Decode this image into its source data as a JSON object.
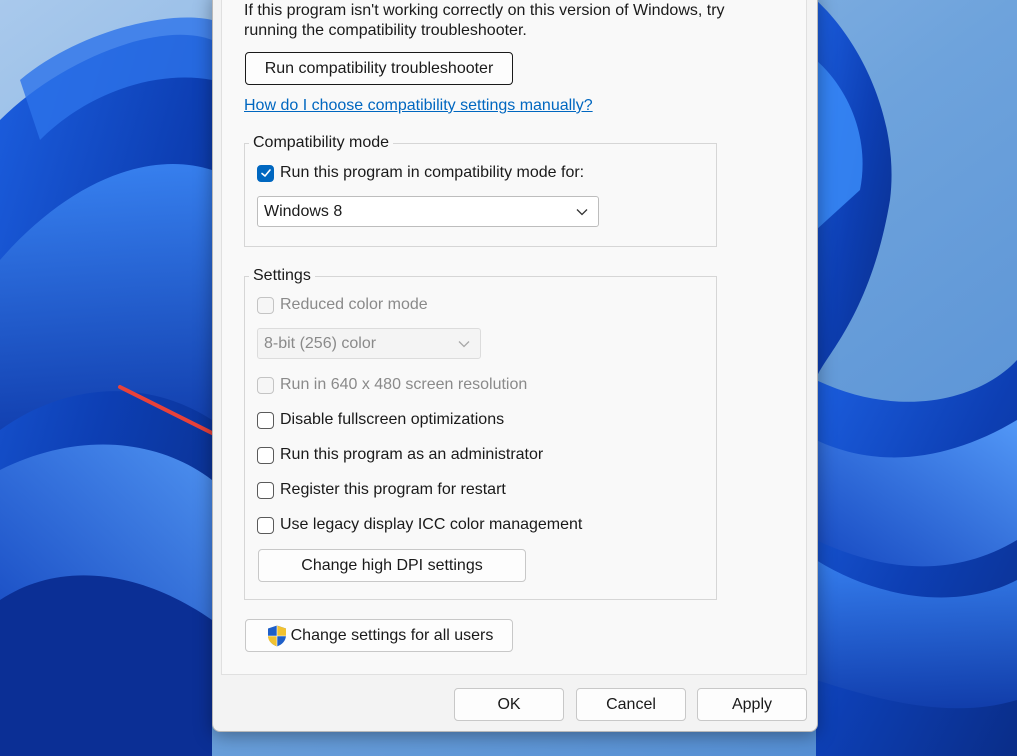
{
  "intro": {
    "line1": "If this program isn't working correctly on this version of Windows, try",
    "line2": "running the compatibility troubleshooter."
  },
  "troubleshooter_button": "Run compatibility troubleshooter",
  "help_link": "How do I choose compatibility settings manually?",
  "compat_mode": {
    "legend": "Compatibility mode",
    "checkbox_label": "Run this program in compatibility mode for:",
    "checked": true,
    "selected_os": "Windows 8"
  },
  "settings": {
    "legend": "Settings",
    "reduced_color": {
      "label": "Reduced color mode",
      "checked": false,
      "enabled": false
    },
    "color_select": "8-bit (256) color",
    "res_640": {
      "label": "Run in 640 x 480 screen resolution",
      "checked": false,
      "enabled": false
    },
    "disable_fullscreen": {
      "label": "Disable fullscreen optimizations",
      "checked": false,
      "enabled": true
    },
    "run_admin": {
      "label": "Run this program as an administrator",
      "checked": false,
      "enabled": true
    },
    "register_restart": {
      "label": "Register this program for restart",
      "checked": false,
      "enabled": true
    },
    "legacy_icc": {
      "label": "Use legacy display ICC color management",
      "checked": false,
      "enabled": true
    },
    "dpi_button": "Change high DPI settings"
  },
  "all_users_button": "Change settings for all users",
  "footer": {
    "ok": "OK",
    "cancel": "Cancel",
    "apply": "Apply"
  },
  "colors": {
    "accent": "#0067c0",
    "annotation_arrow": "#e8423a"
  },
  "icons": {
    "shield": "uac-shield-icon",
    "checkmark": "checkmark-icon",
    "chevron": "chevron-down-icon"
  }
}
